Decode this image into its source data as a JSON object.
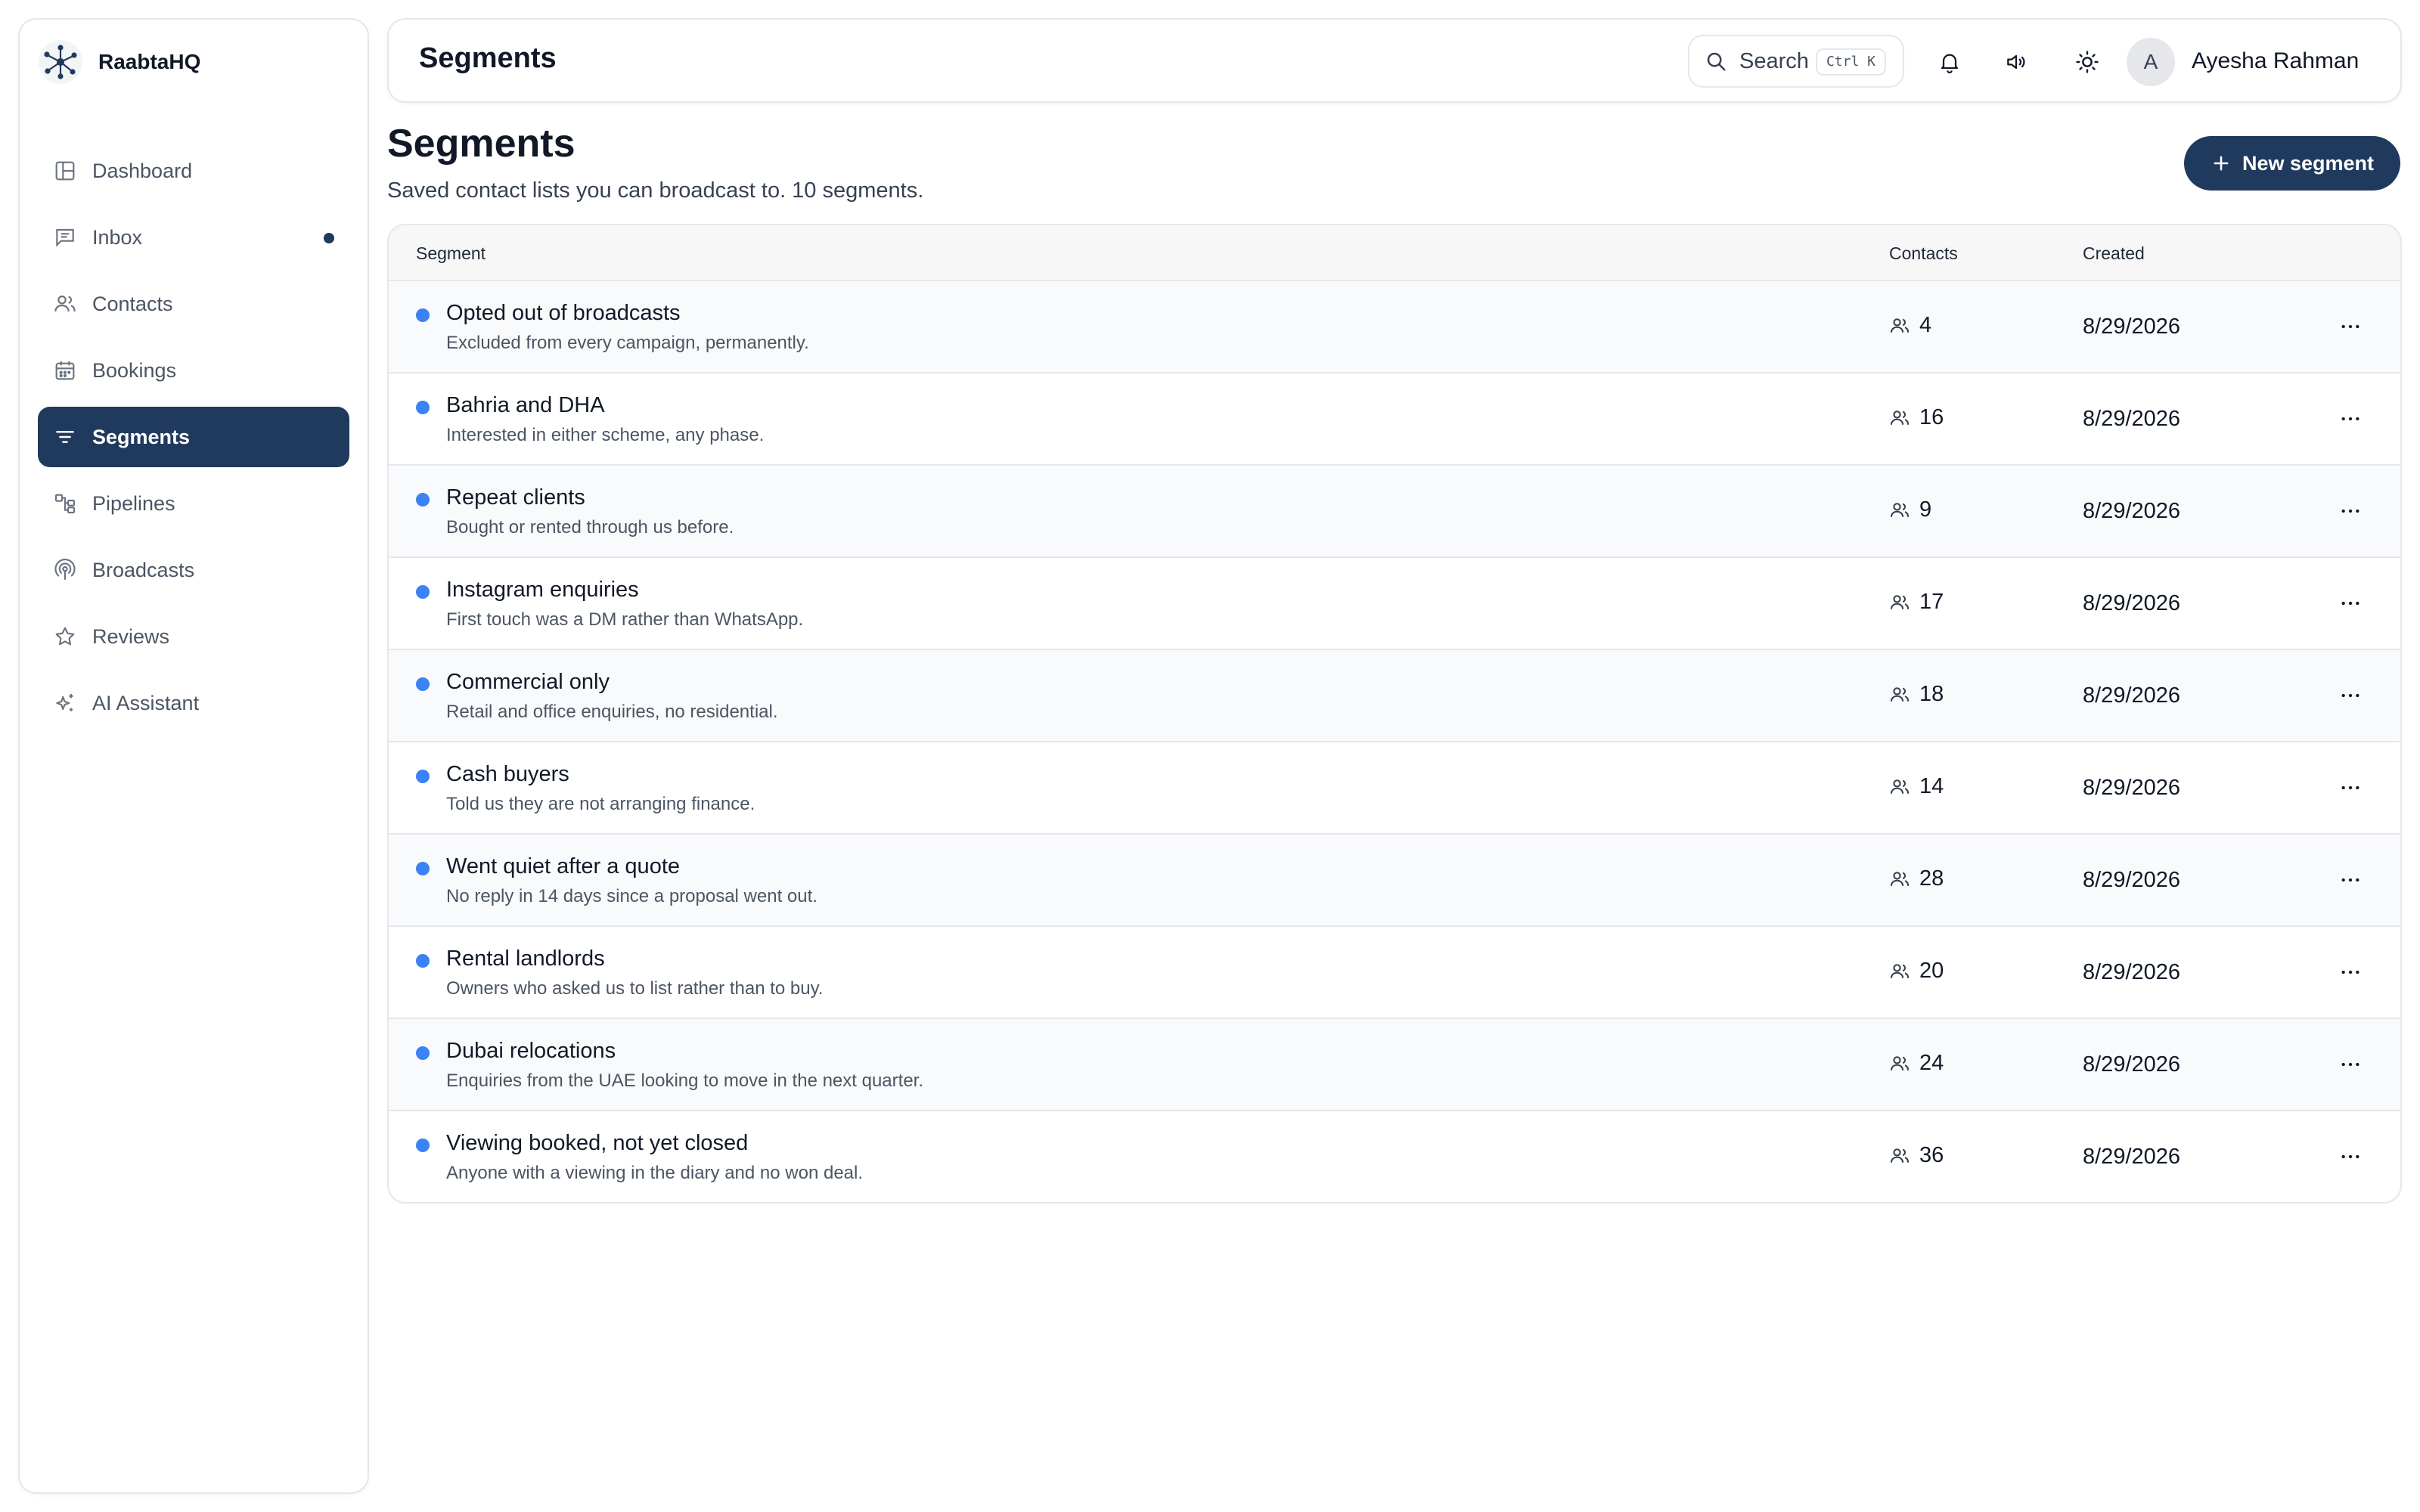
{
  "app": {
    "name": "RaabtaHQ"
  },
  "sidebar": {
    "items": [
      {
        "label": "Dashboard",
        "icon": "layout-icon",
        "active": false
      },
      {
        "label": "Inbox",
        "icon": "message-icon",
        "active": false,
        "has_dot": true
      },
      {
        "label": "Contacts",
        "icon": "users-icon",
        "active": false
      },
      {
        "label": "Bookings",
        "icon": "calendar-icon",
        "active": false
      },
      {
        "label": "Segments",
        "icon": "filter-icon",
        "active": true
      },
      {
        "label": "Pipelines",
        "icon": "workflow-icon",
        "active": false
      },
      {
        "label": "Broadcasts",
        "icon": "broadcast-icon",
        "active": false
      },
      {
        "label": "Reviews",
        "icon": "star-icon",
        "active": false
      },
      {
        "label": "AI Assistant",
        "icon": "sparkles-icon",
        "active": false
      }
    ]
  },
  "header": {
    "title": "Segments",
    "search": {
      "label": "Search",
      "shortcut": "Ctrl K"
    },
    "user": {
      "initial": "A",
      "name": "Ayesha Rahman"
    }
  },
  "page": {
    "title": "Segments",
    "subtitle": "Saved contact lists you can broadcast to. 10 segments.",
    "new_button": "New segment"
  },
  "table": {
    "columns": {
      "segment": "Segment",
      "contacts": "Contacts",
      "created": "Created"
    },
    "rows": [
      {
        "name": "Opted out of broadcasts",
        "description": "Excluded from every campaign, permanently.",
        "contacts": "4",
        "created": "8/29/2026"
      },
      {
        "name": "Bahria and DHA",
        "description": "Interested in either scheme, any phase.",
        "contacts": "16",
        "created": "8/29/2026"
      },
      {
        "name": "Repeat clients",
        "description": "Bought or rented through us before.",
        "contacts": "9",
        "created": "8/29/2026"
      },
      {
        "name": "Instagram enquiries",
        "description": "First touch was a DM rather than WhatsApp.",
        "contacts": "17",
        "created": "8/29/2026"
      },
      {
        "name": "Commercial only",
        "description": "Retail and office enquiries, no residential.",
        "contacts": "18",
        "created": "8/29/2026"
      },
      {
        "name": "Cash buyers",
        "description": "Told us they are not arranging finance.",
        "contacts": "14",
        "created": "8/29/2026"
      },
      {
        "name": "Went quiet after a quote",
        "description": "No reply in 14 days since a proposal went out.",
        "contacts": "28",
        "created": "8/29/2026"
      },
      {
        "name": "Rental landlords",
        "description": "Owners who asked us to list rather than to buy.",
        "contacts": "20",
        "created": "8/29/2026"
      },
      {
        "name": "Dubai relocations",
        "description": "Enquiries from the UAE looking to move in the next quarter.",
        "contacts": "24",
        "created": "8/29/2026"
      },
      {
        "name": "Viewing booked, not yet closed",
        "description": "Anyone with a viewing in the diary and no won deal.",
        "contacts": "36",
        "created": "8/29/2026"
      }
    ]
  },
  "colors": {
    "primary": "#1f3a5c",
    "row_dot": "#3b82f6",
    "border": "#e5e7eb"
  }
}
